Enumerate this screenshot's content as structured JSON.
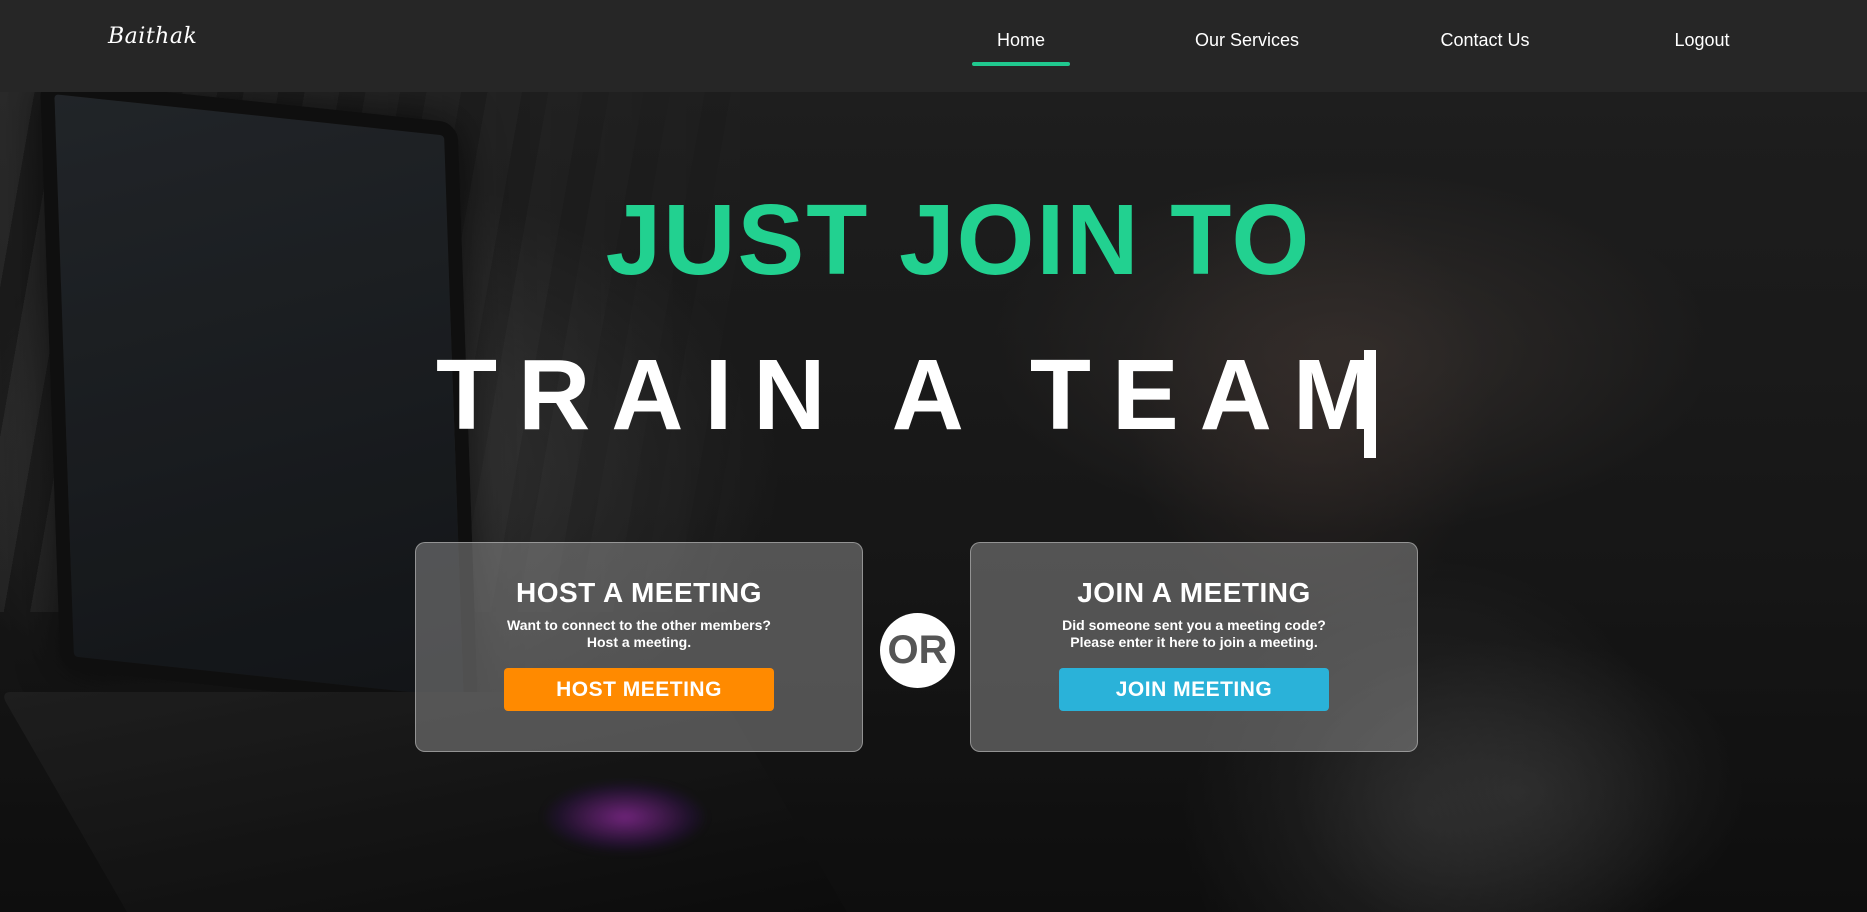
{
  "navbar": {
    "brand": "Baithak",
    "items": [
      {
        "label": "Home",
        "active": true
      },
      {
        "label": "Our Services"
      },
      {
        "label": "Contact Us"
      },
      {
        "label": "Logout"
      }
    ],
    "accent": "#20c98f"
  },
  "hero": {
    "headline_1": "JUST JOIN TO",
    "headline_2": "TRAIN A TEAM",
    "headline_1_color": "#22d190"
  },
  "host_card": {
    "title": "HOST A MEETING",
    "desc_line_1": "Want to connect to the other members?",
    "desc_line_2": "Host a meeting.",
    "button_label": "HOST MEETING",
    "button_color": "#ff8a00"
  },
  "separator": {
    "label": "OR"
  },
  "join_card": {
    "title": "JOIN A MEETING",
    "desc_line_1": "Did someone sent you a meeting code?",
    "desc_line_2": "Please enter it here to join a meeting.",
    "button_label": "JOIN MEETING",
    "button_color": "#2ab2d9"
  }
}
